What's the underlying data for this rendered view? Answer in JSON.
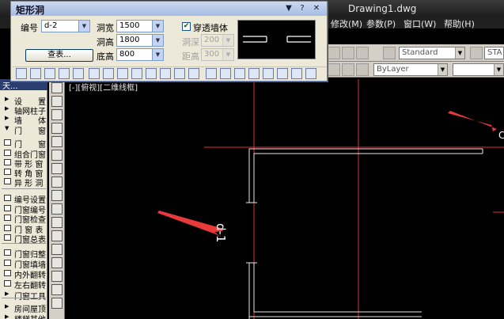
{
  "app": {
    "title": "Drawing1.dwg",
    "menu": [
      "修改(M)",
      "参数(P)",
      "窗口(W)",
      "帮助(H)"
    ]
  },
  "dialog": {
    "title": "矩形洞",
    "controls": [
      "▼",
      "?",
      "✕"
    ],
    "number_label": "编号",
    "number_value": "d-2",
    "width_label": "洞宽",
    "width_value": "1500",
    "height_label": "洞高",
    "height_value": "1800",
    "sill_label": "底高",
    "sill_value": "800",
    "query_button": "查表...",
    "through_wall_label": "穿透墙体",
    "through_wall_checked": true,
    "depth_label": "洞深",
    "depth_value": "200",
    "distance_label": "距高",
    "distance_value": "300"
  },
  "toolbar_right": {
    "style1": "Standard",
    "style2": "STA",
    "layer": "ByLayer"
  },
  "palette": {
    "header": "天...",
    "items": [
      {
        "label": "设　　置",
        "icon": "arrow"
      },
      {
        "label": "轴网柱子",
        "icon": "arrow"
      },
      {
        "label": "墙　　体",
        "icon": "arrow"
      },
      {
        "label": "门　　窗",
        "icon": "arrow-down"
      },
      {
        "label": "门　　窗",
        "icon": "door"
      },
      {
        "label": "组合门窗",
        "icon": "door"
      },
      {
        "label": "带 形 窗",
        "icon": "window"
      },
      {
        "label": "转 角 窗",
        "icon": "window"
      },
      {
        "label": "异 形 洞",
        "icon": "door"
      },
      {
        "label": "编号设置",
        "icon": "tool"
      },
      {
        "label": "门窗编号",
        "icon": "tool"
      },
      {
        "label": "门窗检查",
        "icon": "tool"
      },
      {
        "label": "门 窗 表",
        "icon": "table"
      },
      {
        "label": "门窗总表",
        "icon": "table"
      },
      {
        "label": "门窗归整",
        "icon": "tool"
      },
      {
        "label": "门窗填墙",
        "icon": "tool"
      },
      {
        "label": "内外翻转",
        "icon": "tool"
      },
      {
        "label": "左右翻转",
        "icon": "tool"
      },
      {
        "label": "门窗工具",
        "icon": "arrow"
      },
      {
        "label": "房间屋顶",
        "icon": "arrow"
      },
      {
        "label": "楼梯其他",
        "icon": "arrow"
      }
    ]
  },
  "canvas": {
    "view_label": "[-][俯视][二维线框]",
    "door_tag": "d-1",
    "side_text": "C"
  },
  "colors": {
    "red_line": "#e0303a",
    "wall_line": "#e8e8e8",
    "arrow": "#e83a3a"
  }
}
